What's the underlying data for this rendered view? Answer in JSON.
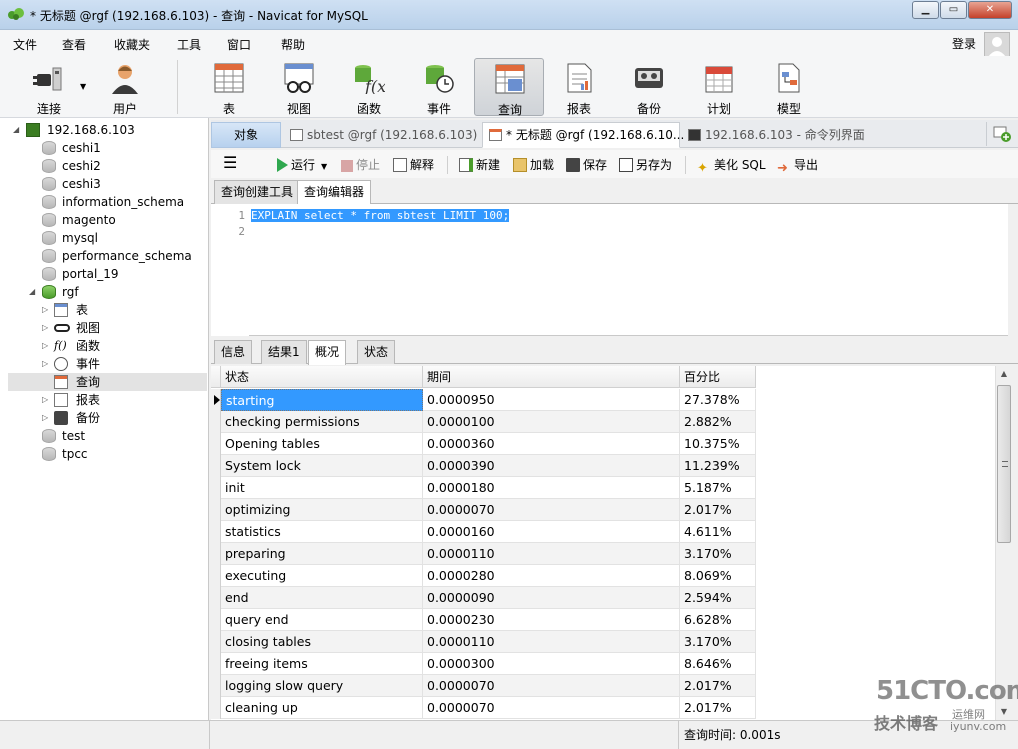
{
  "window": {
    "title": "* 无标题 @rgf (192.168.6.103) - 查询 - Navicat for MySQL",
    "minimize": "▁",
    "maximize": "▭",
    "close": "✕"
  },
  "menu": [
    "文件",
    "查看",
    "收藏夹",
    "工具",
    "窗口",
    "帮助"
  ],
  "login": "登录",
  "toolbar": [
    {
      "label": "连接",
      "icon": "plug-icon"
    },
    {
      "label": "用户",
      "icon": "user-icon"
    },
    {
      "label": "表",
      "icon": "table-icon"
    },
    {
      "label": "视图",
      "icon": "view-icon"
    },
    {
      "label": "函数",
      "icon": "function-icon"
    },
    {
      "label": "事件",
      "icon": "event-icon"
    },
    {
      "label": "查询",
      "icon": "query-icon"
    },
    {
      "label": "报表",
      "icon": "report-icon"
    },
    {
      "label": "备份",
      "icon": "backup-icon"
    },
    {
      "label": "计划",
      "icon": "schedule-icon"
    },
    {
      "label": "模型",
      "icon": "model-icon"
    }
  ],
  "tree": {
    "connection": "192.168.6.103",
    "databases": [
      "ceshi1",
      "ceshi2",
      "ceshi3",
      "information_schema",
      "magento",
      "mysql",
      "performance_schema",
      "portal_19",
      "rgf",
      "test",
      "tpcc"
    ],
    "rgf_children": [
      "表",
      "视图",
      "函数",
      "事件",
      "查询",
      "报表",
      "备份"
    ],
    "function_prefix": "f()"
  },
  "tabs": {
    "objects": "对象",
    "tab1": "sbtest @rgf (192.168.6.103) ...",
    "tab2": "* 无标题 @rgf (192.168.6.10...",
    "tab3": "192.168.6.103 - 命令列界面"
  },
  "qtoolbar": {
    "menu": "☰",
    "run": "运行",
    "stop": "停止",
    "explain": "解释",
    "new": "新建",
    "load": "加载",
    "save": "保存",
    "saveas": "另存为",
    "beautify": "美化 SQL",
    "export": "导出"
  },
  "editor_tabs": [
    "查询创建工具",
    "查询编辑器"
  ],
  "editor": {
    "line1": "1",
    "line2": "2",
    "code": "EXPLAIN select * from sbtest LIMIT 100;"
  },
  "result_tabs": [
    "信息",
    "结果1",
    "概况",
    "状态"
  ],
  "grid": {
    "headers": [
      "状态",
      "期间",
      "百分比"
    ],
    "rows": [
      [
        "starting",
        "0.0000950",
        "27.378%"
      ],
      [
        "checking permissions",
        "0.0000100",
        "2.882%"
      ],
      [
        "Opening tables",
        "0.0000360",
        "10.375%"
      ],
      [
        "System lock",
        "0.0000390",
        "11.239%"
      ],
      [
        "init",
        "0.0000180",
        "5.187%"
      ],
      [
        "optimizing",
        "0.0000070",
        "2.017%"
      ],
      [
        "statistics",
        "0.0000160",
        "4.611%"
      ],
      [
        "preparing",
        "0.0000110",
        "3.170%"
      ],
      [
        "executing",
        "0.0000280",
        "8.069%"
      ],
      [
        "end",
        "0.0000090",
        "2.594%"
      ],
      [
        "query end",
        "0.0000230",
        "6.628%"
      ],
      [
        "closing tables",
        "0.0000110",
        "3.170%"
      ],
      [
        "freeing items",
        "0.0000300",
        "8.646%"
      ],
      [
        "logging slow query",
        "0.0000070",
        "2.017%"
      ],
      [
        "cleaning up",
        "0.0000070",
        "2.017%"
      ]
    ]
  },
  "status": {
    "query_time": "查询时间: 0.001s"
  },
  "watermark": {
    "line1": "51CTO.com",
    "line2": "技术博客",
    "line3": "运维网",
    "line4": "iyunv.com"
  },
  "colors": {
    "selection": "#3399ff",
    "title_bar": "#c4d8ee",
    "objects_tab": "#c6dbf2"
  }
}
